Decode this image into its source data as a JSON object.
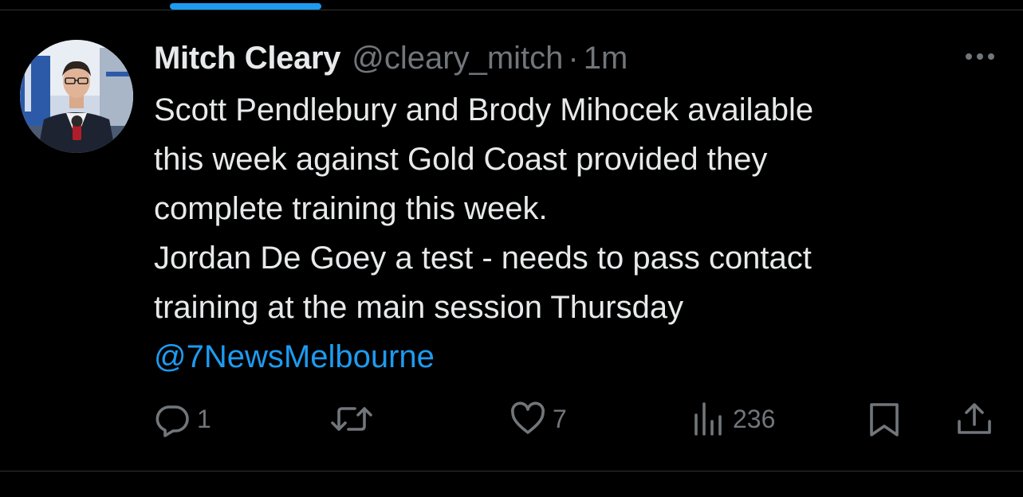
{
  "colors": {
    "background": "#000000",
    "primary_text": "#e7e9ea",
    "secondary_text": "#71767b",
    "link": "#1d9bf0",
    "tab_indicator": "#1d9bf0",
    "divider": "#2f3336"
  },
  "tweet": {
    "author": {
      "display_name": "Mitch Cleary",
      "handle": "@cleary_mitch",
      "avatar_icon": "avatar-photo"
    },
    "separator": "·",
    "time": "1m",
    "more_icon": "more-dots-icon",
    "text_lines": [
      "Scott Pendlebury and Brody Mihocek available",
      "this week against Gold Coast provided they",
      "complete training this week.",
      "Jordan De Goey a test - needs to pass contact",
      "training at the main session Thursday"
    ],
    "mention": "@7NewsMelbourne",
    "actions": {
      "reply": {
        "icon": "reply-icon",
        "count": "1"
      },
      "retweet": {
        "icon": "retweet-icon",
        "count": ""
      },
      "like": {
        "icon": "heart-icon",
        "count": "7"
      },
      "views": {
        "icon": "views-icon",
        "count": "236"
      },
      "bookmark": {
        "icon": "bookmark-icon"
      },
      "share": {
        "icon": "share-icon"
      }
    }
  }
}
